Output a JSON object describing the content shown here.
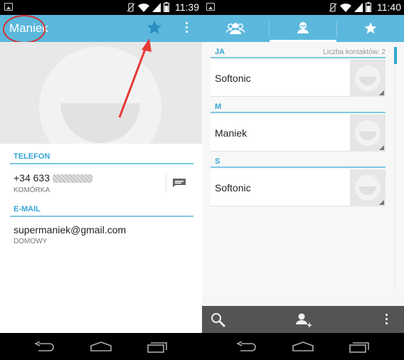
{
  "left": {
    "status": {
      "time": "11:39"
    },
    "contact_name": "Maniek",
    "sections": {
      "phone": {
        "header": "TELEFON",
        "number": "+34 633",
        "type": "KOMÓRKA"
      },
      "email": {
        "header": "E-MAIL",
        "address": "supermaniek@gmail.com",
        "type": "DOMOWY"
      }
    },
    "icons": [
      "back-chevron-icon",
      "star-icon",
      "overflow-menu-icon",
      "message-icon"
    ],
    "annotation_color": "#d32f2f"
  },
  "right": {
    "status": {
      "time": "11:40"
    },
    "tabs": [
      {
        "name": "groups",
        "icon": "group-icon"
      },
      {
        "name": "all",
        "icon": "person-icon",
        "active": true
      },
      {
        "name": "favorites",
        "icon": "star-icon"
      }
    ],
    "groups": [
      {
        "header": "JA",
        "count_label": "Liczba kontaktów: 2",
        "contact": "Softonic"
      },
      {
        "header": "M",
        "contact": "Maniek"
      },
      {
        "header": "S",
        "contact": "Softonic"
      }
    ],
    "bottom_actions": [
      "search-icon",
      "add-contact-icon",
      "overflow-menu-icon"
    ]
  },
  "colors": {
    "accent": "#5bb8dc",
    "header_text": "#33a6d6",
    "bottom_bar": "#545454"
  }
}
